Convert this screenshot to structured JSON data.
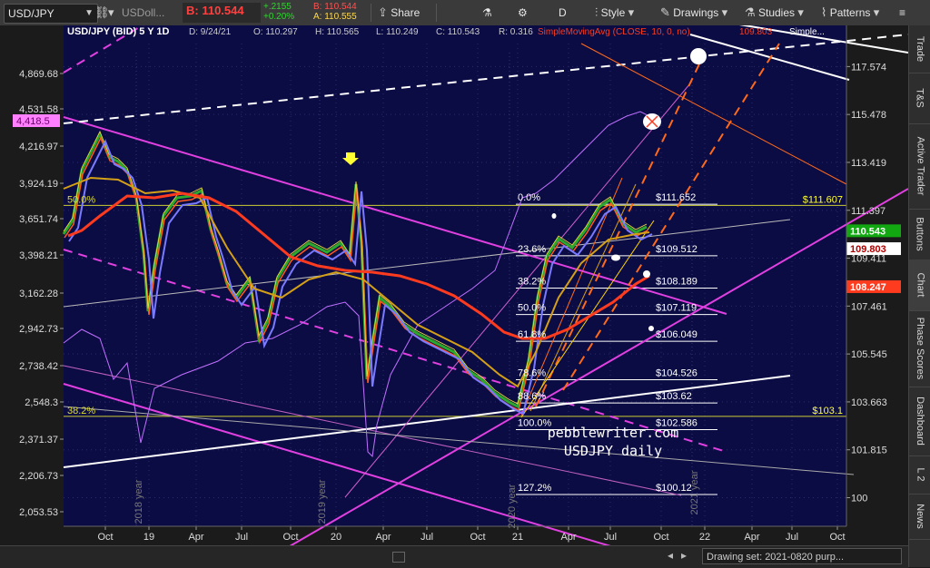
{
  "toolbar": {
    "symbol": "USD/JPY",
    "comparison": "USDoll...",
    "bid_label": "B: 110.544",
    "change": "+.2155",
    "change_pct": "+0.20%",
    "bid_small": "B: 110.544",
    "ask_small": "A: 110.555",
    "share": "Share",
    "period": "D",
    "style": "Style",
    "drawings": "Drawings",
    "studies": "Studies",
    "patterns": "Patterns"
  },
  "sidebar": {
    "tabs": [
      "Trade",
      "T&S",
      "Active Trader",
      "Buttons",
      "Chart",
      "Phase Scores",
      "Dashboard",
      "L 2",
      "News"
    ]
  },
  "bottom": {
    "drawing_set": "Drawing set: 2021-0820 purp..."
  },
  "colors": {
    "background": "#0c0c44",
    "primary_lines": "#e040e0",
    "fib": "#cccc33",
    "ma_red": "#ff3b1f",
    "ma_gold": "#d4a017",
    "ma_blue": "#7a7aff",
    "dash_orange": "#ff6a1a"
  },
  "chart_data": {
    "type": "line",
    "header": {
      "title": "USD/JPY (BID) 5 Y 1D",
      "date": "D: 9/24/21",
      "open": "O: 110.297",
      "high": "H: 110.565",
      "low": "L: 110.249",
      "close": "C: 110.543",
      "range": "R: 0.316",
      "study": "SimpleMovingAvg (CLOSE, 10, 0, no)",
      "study_value": "109.803",
      "extra": "Simple..."
    },
    "x_ticks": [
      "Oct",
      "19",
      "Apr",
      "Jul",
      "Oct",
      "20",
      "Apr",
      "Jul",
      "Oct",
      "21",
      "Apr",
      "Jul",
      "Oct",
      "22",
      "Apr",
      "Jul",
      "Oct"
    ],
    "right_axis": {
      "ticks": [
        "117.574",
        "115.478",
        "113.419",
        "111.397",
        "109.411",
        "107.461",
        "105.545",
        "103.663",
        "101.815",
        "100"
      ],
      "labels": [
        {
          "text": "110.543",
          "bg": "#11a811",
          "fg": "#ffffff"
        },
        {
          "text": "109.803",
          "bg": "#ffffff",
          "fg": "#b00000"
        },
        {
          "text": "108.247",
          "bg": "#ff3b1f",
          "fg": "#ffffff"
        }
      ]
    },
    "left_axis": {
      "ticks": [
        "4,869.68",
        "4,531.58",
        "4,216.97",
        "3,924.19",
        "3,651.74",
        "3,398.21",
        "3,162.28",
        "2,942.73",
        "2,738.42",
        "2,548.3",
        "2,371.37",
        "2,206.73",
        "2,053.53"
      ],
      "highlight": "4,418.5"
    },
    "fib_levels": [
      {
        "pct": "0.0%",
        "price": "$111.652",
        "y": 111.65
      },
      {
        "pct": "23.6%",
        "price": "$109.512",
        "y": 109.51
      },
      {
        "pct": "38.2%",
        "price": "$108.189",
        "y": 108.19
      },
      {
        "pct": "50.0%",
        "price": "$107.119",
        "y": 107.12
      },
      {
        "pct": "61.8%",
        "price": "$106.049",
        "y": 106.05
      },
      {
        "pct": "78.6%",
        "price": "$104.526",
        "y": 104.53
      },
      {
        "pct": "88.6%",
        "price": "$103.62",
        "y": 103.62
      },
      {
        "pct": "100.0%",
        "price": "$102.586",
        "y": 102.59
      },
      {
        "pct": "127.2%",
        "price": "$100.12",
        "y": 100.12
      }
    ],
    "horizontal_levels": [
      {
        "left_pct": "50.0%",
        "right_label": "$111.607",
        "y": 111.6
      },
      {
        "left_pct": "38.2%",
        "right_label": "$103.1",
        "y": 103.1
      }
    ],
    "year_labels": [
      "2018 year",
      "2019 year",
      "2020 year",
      "2021 year"
    ],
    "watermark": [
      "pebblewriter.com",
      "USDJPY daily"
    ],
    "ylim": [
      99,
      119
    ]
  }
}
